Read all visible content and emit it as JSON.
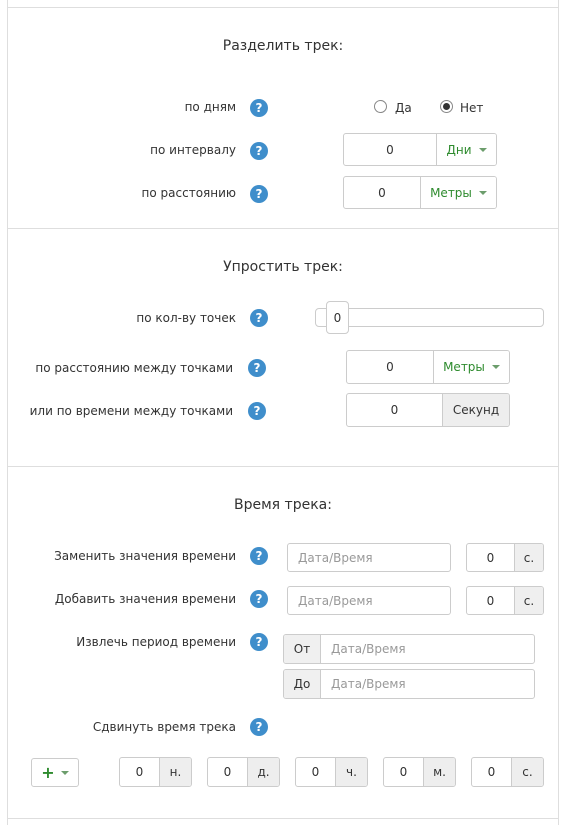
{
  "split": {
    "title": "Разделить трек:",
    "by_days": {
      "label": "по дням",
      "yes": "Да",
      "no": "Нет",
      "selected": "Нет"
    },
    "by_interval": {
      "label": "по интервалу",
      "value": "0",
      "unit": "Дни"
    },
    "by_distance": {
      "label": "по расстоянию",
      "value": "0",
      "unit": "Метры"
    }
  },
  "simplify": {
    "title": "Упростить трек:",
    "by_points": {
      "label": "по кол-ву точек",
      "value": "0"
    },
    "by_distance": {
      "label": "по расстоянию между точками",
      "value": "0",
      "unit": "Метры"
    },
    "by_time": {
      "label": "или по времени между точками",
      "value": "0",
      "unit": "Секунд"
    }
  },
  "time": {
    "title": "Время трека:",
    "replace": {
      "label": "Заменить значения времени",
      "placeholder": "Дата/Время",
      "seconds": "0",
      "unit": "с."
    },
    "add": {
      "label": "Добавить значения времени",
      "placeholder": "Дата/Время",
      "seconds": "0",
      "unit": "с."
    },
    "extract": {
      "label": "Извлечь период времени",
      "from": "От",
      "to": "До",
      "placeholder": "Дата/Время"
    },
    "shift": {
      "label": "Сдвинуть время трека",
      "parts": [
        {
          "value": "0",
          "unit": "н."
        },
        {
          "value": "0",
          "unit": "д."
        },
        {
          "value": "0",
          "unit": "ч."
        },
        {
          "value": "0",
          "unit": "м."
        },
        {
          "value": "0",
          "unit": "с."
        }
      ]
    }
  },
  "icons": {
    "help": "?",
    "plus": "+"
  },
  "colors": {
    "help": "#3f8ecb",
    "accent_green": "#2e8b2e",
    "border": "#cccccc",
    "divider": "#dedede"
  }
}
